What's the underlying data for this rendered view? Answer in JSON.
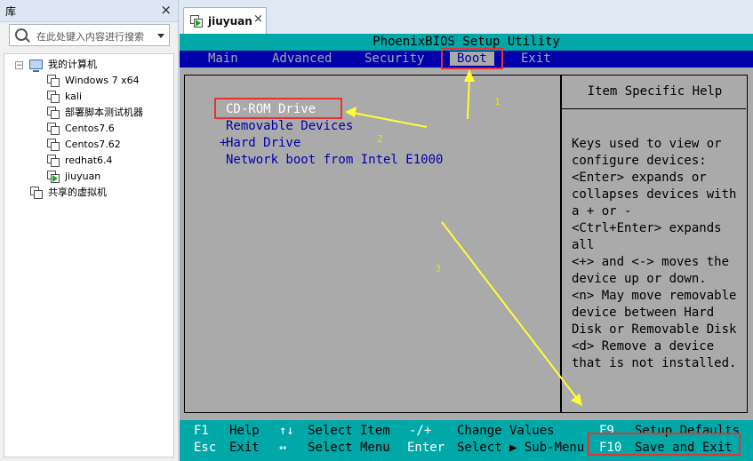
{
  "library": {
    "title": "库",
    "close_glyph": "×",
    "search_placeholder": "在此处键入内容进行搜索",
    "tree": {
      "root": "我的计算机",
      "vms": [
        "Windows 7 x64",
        "kali",
        "部署脚本测试机器",
        "Centos7.6",
        "Centos7.62",
        "redhat6.4",
        "jiuyuan"
      ],
      "shared": "共享的虚拟机"
    }
  },
  "tab": {
    "label": "jiuyuan",
    "close_glyph": "×"
  },
  "bios": {
    "title": "PhoenixBIOS Setup Utility",
    "menu": [
      "Main",
      "Advanced",
      "Security",
      "Boot",
      "Exit"
    ],
    "active_menu": "Boot",
    "boot_items": [
      "CD-ROM Drive",
      "Removable Devices",
      "Hard Drive",
      "Network boot from Intel E1000"
    ],
    "hard_drive_prefix": "+",
    "help_title": "Item Specific Help",
    "help_lines": [
      "Keys used to view or",
      "configure devices:",
      "<Enter> expands or",
      "collapses devices with",
      "a + or -",
      "<Ctrl+Enter> expands",
      "all",
      "<+> and <-> moves the",
      "device up or down.",
      "<n> May move removable",
      "device between Hard",
      "Disk or Removable Disk",
      "<d> Remove a device",
      "that is not installed."
    ],
    "footer": {
      "row1": [
        {
          "key": "F1",
          "desc": "Help"
        },
        {
          "key": "↑↓",
          "desc": "Select Item"
        },
        {
          "key": "-/+",
          "desc": "Change Values"
        },
        {
          "key": "F9",
          "desc": "Setup Defaults"
        }
      ],
      "row2": [
        {
          "key": "Esc",
          "desc": "Exit"
        },
        {
          "key": "↔",
          "desc": "Select Menu"
        },
        {
          "key": "Enter",
          "desc": "Select ▶ Sub-Menu"
        },
        {
          "key": "F10",
          "desc": "Save and Exit"
        }
      ]
    }
  },
  "annotations": {
    "labels": [
      "1",
      "2",
      "3"
    ],
    "box_color": "#e53333",
    "arrow_color": "#ffff33"
  },
  "colors": {
    "bios_gray": "#aaaaaa",
    "bios_blue": "#0000aa",
    "bios_cyan": "#00a8a8"
  }
}
